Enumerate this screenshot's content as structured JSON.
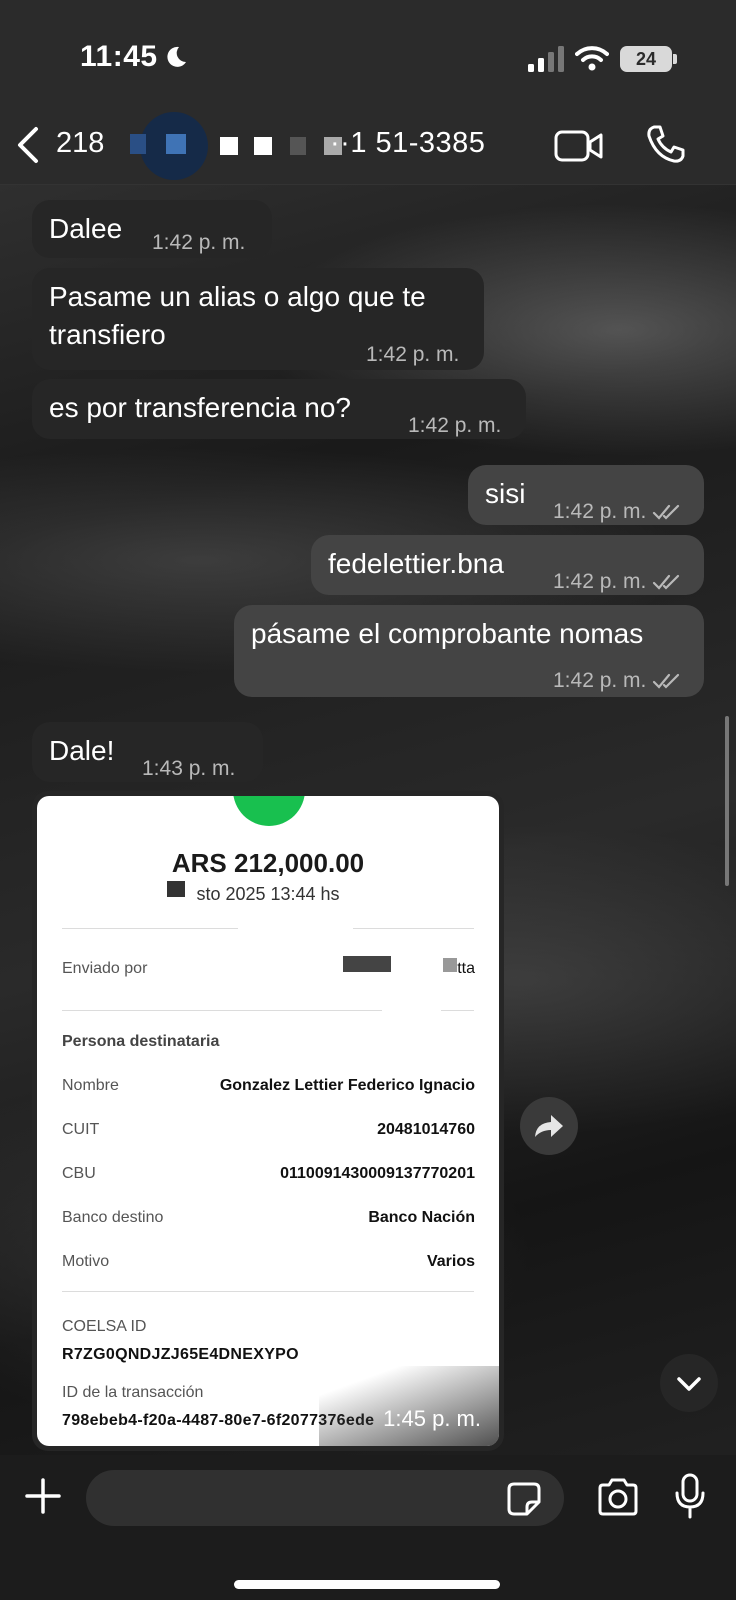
{
  "status_bar": {
    "time": "11:45",
    "battery": "24"
  },
  "header": {
    "back_count": "218",
    "contact_name": "··1 51-3385"
  },
  "messages": [
    {
      "text": "Dalee",
      "time": "1:42 p. m."
    },
    {
      "text_line1": "Pasame un alias o algo que te",
      "text_line2": "transfiero",
      "time": "1:42 p. m."
    },
    {
      "text": "es por transferencia no?",
      "time": "1:42 p. m."
    },
    {
      "text": "sisi",
      "time": "1:42 p. m."
    },
    {
      "text": "fedelettier.bna",
      "time": "1:42 p. m."
    },
    {
      "text": "pásame el comprobante nomas",
      "time": "1:42 p. m."
    },
    {
      "text": "Dale!",
      "time": "1:43 p. m."
    }
  ],
  "receipt": {
    "amount": "ARS 212,000.00",
    "date": "sto 2025 13:44 hs",
    "sent_by_label": "Enviado por",
    "sent_by_value": "tta",
    "recipient_section": "Persona destinataria",
    "rows": [
      {
        "label": "Nombre",
        "value": "Gonzalez Lettier Federico Ignacio"
      },
      {
        "label": "CUIT",
        "value": "20481014760"
      },
      {
        "label": "CBU",
        "value": "0110091430009137770201"
      },
      {
        "label": "Banco destino",
        "value": "Banco Nación"
      },
      {
        "label": "Motivo",
        "value": "Varios"
      }
    ],
    "coelsa_label": "COELSA ID",
    "coelsa_value": "R7ZG0QNDJZJ65E4DNEXYPO",
    "tx_label": "ID de la transacción",
    "tx_value": "798ebeb4-f20a-4487-80e7-6f2077376ede",
    "time": "1:45 p. m."
  },
  "icons": {
    "back": "chevron-left-icon",
    "video": "video-camera-icon",
    "phone": "phone-icon",
    "forward": "forward-arrow-icon",
    "scroll": "chevron-down-icon",
    "plus": "plus-icon",
    "sticker": "sticker-icon",
    "camera": "camera-icon",
    "mic": "microphone-icon"
  },
  "colors": {
    "incoming_bubble": "#262626",
    "outgoing_bubble": "#444444",
    "success_green": "#18c04f"
  }
}
